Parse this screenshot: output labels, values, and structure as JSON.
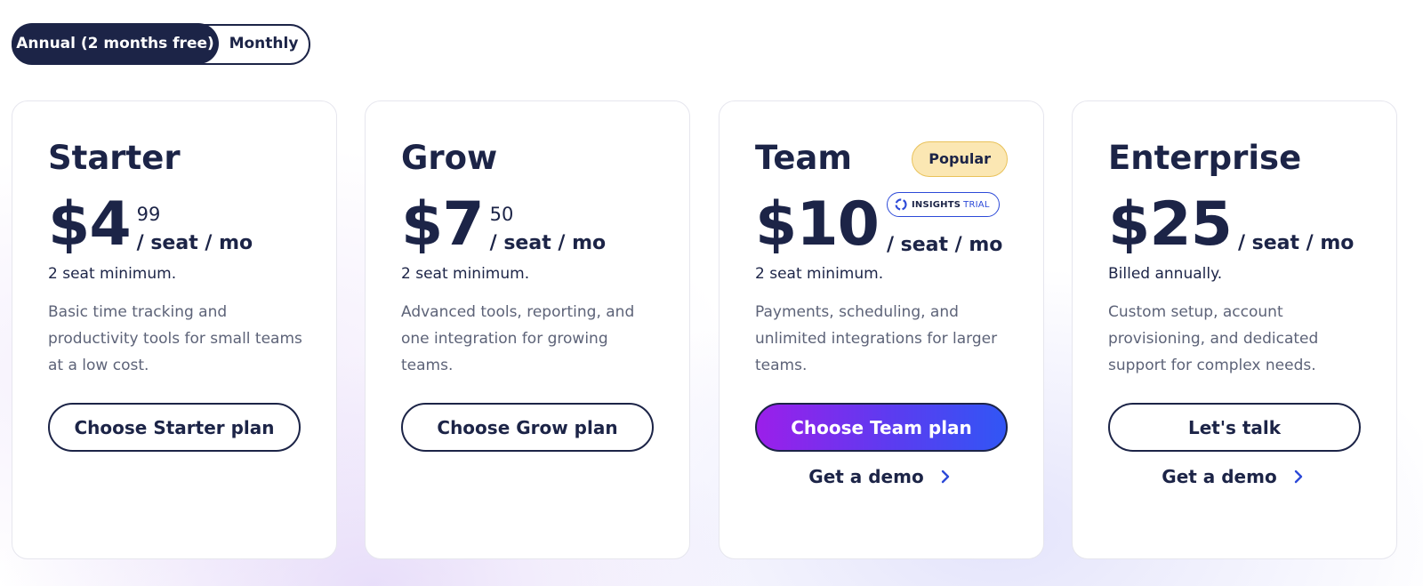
{
  "billing_toggle": {
    "annual_label": "Annual (2 months free)",
    "monthly_label": "Monthly",
    "selected": "annual"
  },
  "plans": [
    {
      "name": "Starter",
      "price": "$4",
      "cents": "99",
      "per": "/ seat / mo",
      "minimum": "2 seat minimum.",
      "description": "Basic time tracking and productivity tools for small teams at a low cost.",
      "cta": "Choose Starter plan"
    },
    {
      "name": "Grow",
      "price": "$7",
      "cents": "50",
      "per": "/ seat / mo",
      "minimum": "2 seat minimum.",
      "description": "Advanced tools, reporting, and one integration for growing teams.",
      "cta": "Choose Grow plan"
    },
    {
      "name": "Team",
      "badge": "Popular",
      "price": "$10",
      "trial_badge": {
        "insights": "INSIGHTS",
        "trial": "TRIAL"
      },
      "per": "/ seat / mo",
      "minimum": "2 seat minimum.",
      "description": "Payments, scheduling, and unlimited integrations for larger teams.",
      "cta": "Choose Team plan",
      "demo": "Get a demo"
    },
    {
      "name": "Enterprise",
      "price": "$25",
      "per": "/ seat / mo",
      "minimum": "Billed annually.",
      "description": "Custom setup, account provisioning, and dedicated support for complex needs.",
      "cta": "Let's talk",
      "demo": "Get a demo"
    }
  ],
  "icons": {
    "demo_arrow": "chevron-right-icon",
    "trial_logo": "insights-logo-icon"
  },
  "colors": {
    "navy": "#1c2447",
    "primary_gradient_start": "#9b1fea",
    "primary_gradient_end": "#3156f5",
    "popular_badge_bg": "#fbe7b3",
    "trial_accent": "#2d4ad8"
  }
}
